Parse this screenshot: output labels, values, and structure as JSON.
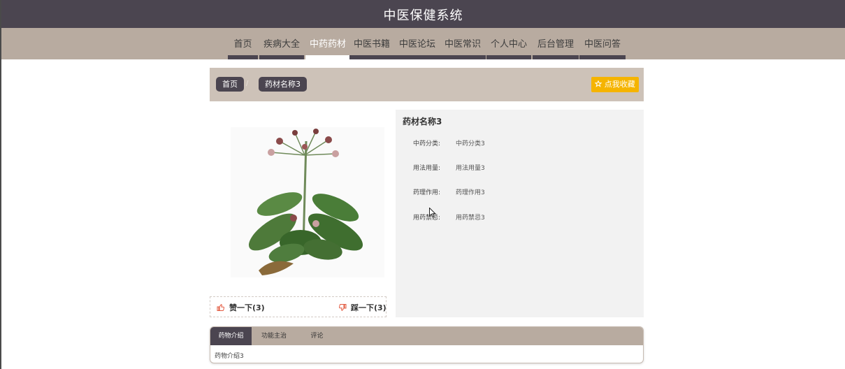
{
  "header": {
    "site_title": "中医保健系统"
  },
  "nav": {
    "items": [
      {
        "label": "首页",
        "active": false
      },
      {
        "label": "疾病大全",
        "active": false
      },
      {
        "label": "中药药材",
        "active": true
      },
      {
        "label": "中医书籍",
        "active": false
      },
      {
        "label": "中医论坛",
        "active": false
      },
      {
        "label": "中医常识",
        "active": false
      },
      {
        "label": "个人中心",
        "active": false
      },
      {
        "label": "后台管理",
        "active": false
      },
      {
        "label": "中医问答",
        "active": false
      }
    ]
  },
  "breadcrumb": {
    "home": "首页",
    "separator": "/",
    "current": "药材名称3"
  },
  "favorite": {
    "label": "点我收藏",
    "icon": "star-outline-icon"
  },
  "vote": {
    "like_label": "赞一下(3)",
    "dislike_label": "踩一下(3)",
    "like_icon": "thumbs-up-icon",
    "dislike_icon": "thumbs-down-icon"
  },
  "detail": {
    "title": "药材名称3",
    "fields": [
      {
        "label": "中药分类:",
        "value": "中药分类3"
      },
      {
        "label": "用法用量:",
        "value": "用法用量3"
      },
      {
        "label": "药理作用:",
        "value": "药理作用3"
      },
      {
        "label": "用药禁忌:",
        "value": "用药禁忌3"
      }
    ]
  },
  "tabs": {
    "items": [
      {
        "label": "药物介绍",
        "active": true
      },
      {
        "label": "功能主治",
        "active": false
      },
      {
        "label": "评论",
        "active": false
      }
    ],
    "content": "药物介绍3"
  },
  "colors": {
    "header_bg": "#4b4550",
    "nav_bg": "#b8aba0",
    "breadcrumb_bg": "#cdc2b8",
    "accent_button": "#f5b400",
    "thumb_icon": "#e2583e",
    "info_bg": "#f2f2f2"
  }
}
